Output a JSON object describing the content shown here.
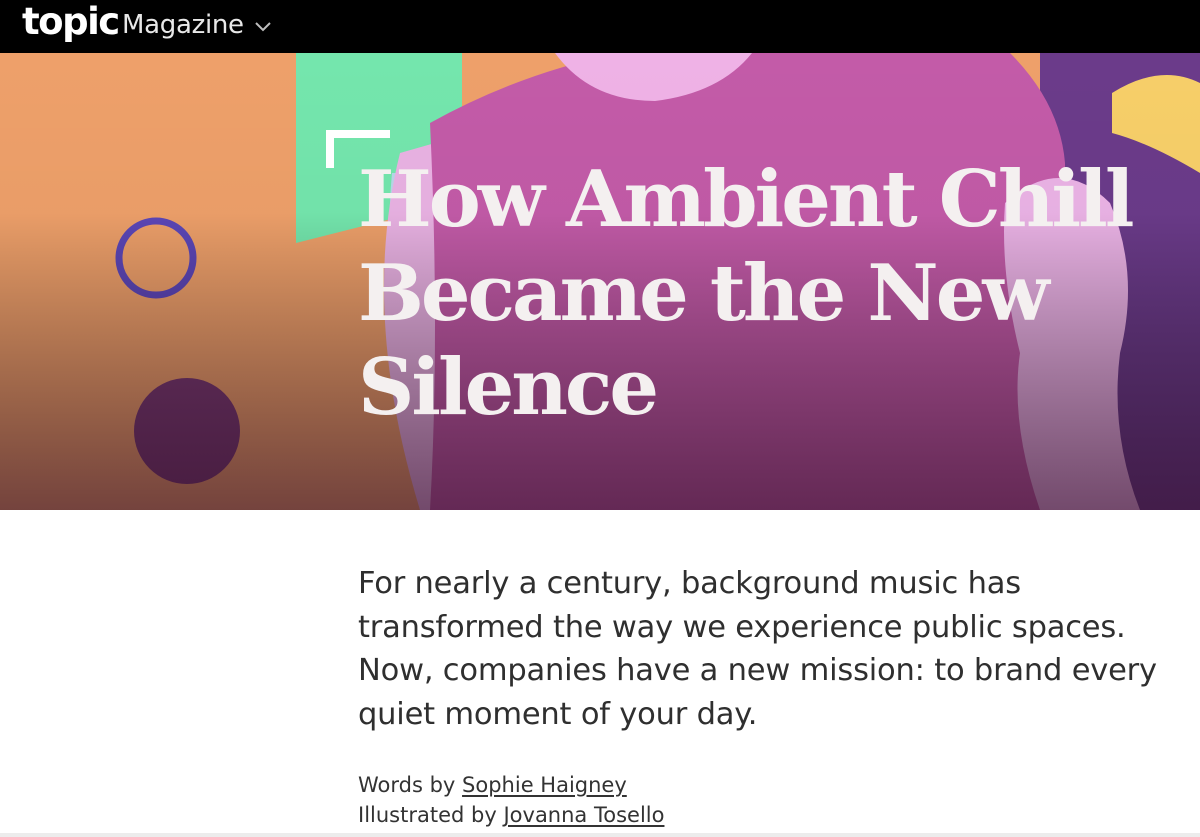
{
  "header": {
    "logo": "topic",
    "section": "Magazine",
    "background_color": "#000000"
  },
  "hero": {
    "headline": "How Ambient Chill Became the New Silence",
    "illustration_colors": {
      "background_orange": "#eea06a",
      "figure_magenta": "#c35ba8",
      "skin_pink": "#efb2e6",
      "green_panel": "#74e6ad",
      "ring_purple": "#6a45bd",
      "yellow_shape": "#f7cf69"
    }
  },
  "article": {
    "dek": "For nearly a century, background music has transformed the way we experience public spaces. Now, companies have a new mission: to brand every quiet moment of your day.",
    "words_prefix": "Words by",
    "author": "Sophie Haigney",
    "illustrated_prefix": "Illustrated by",
    "illustrator": "Jovanna Tosello"
  }
}
